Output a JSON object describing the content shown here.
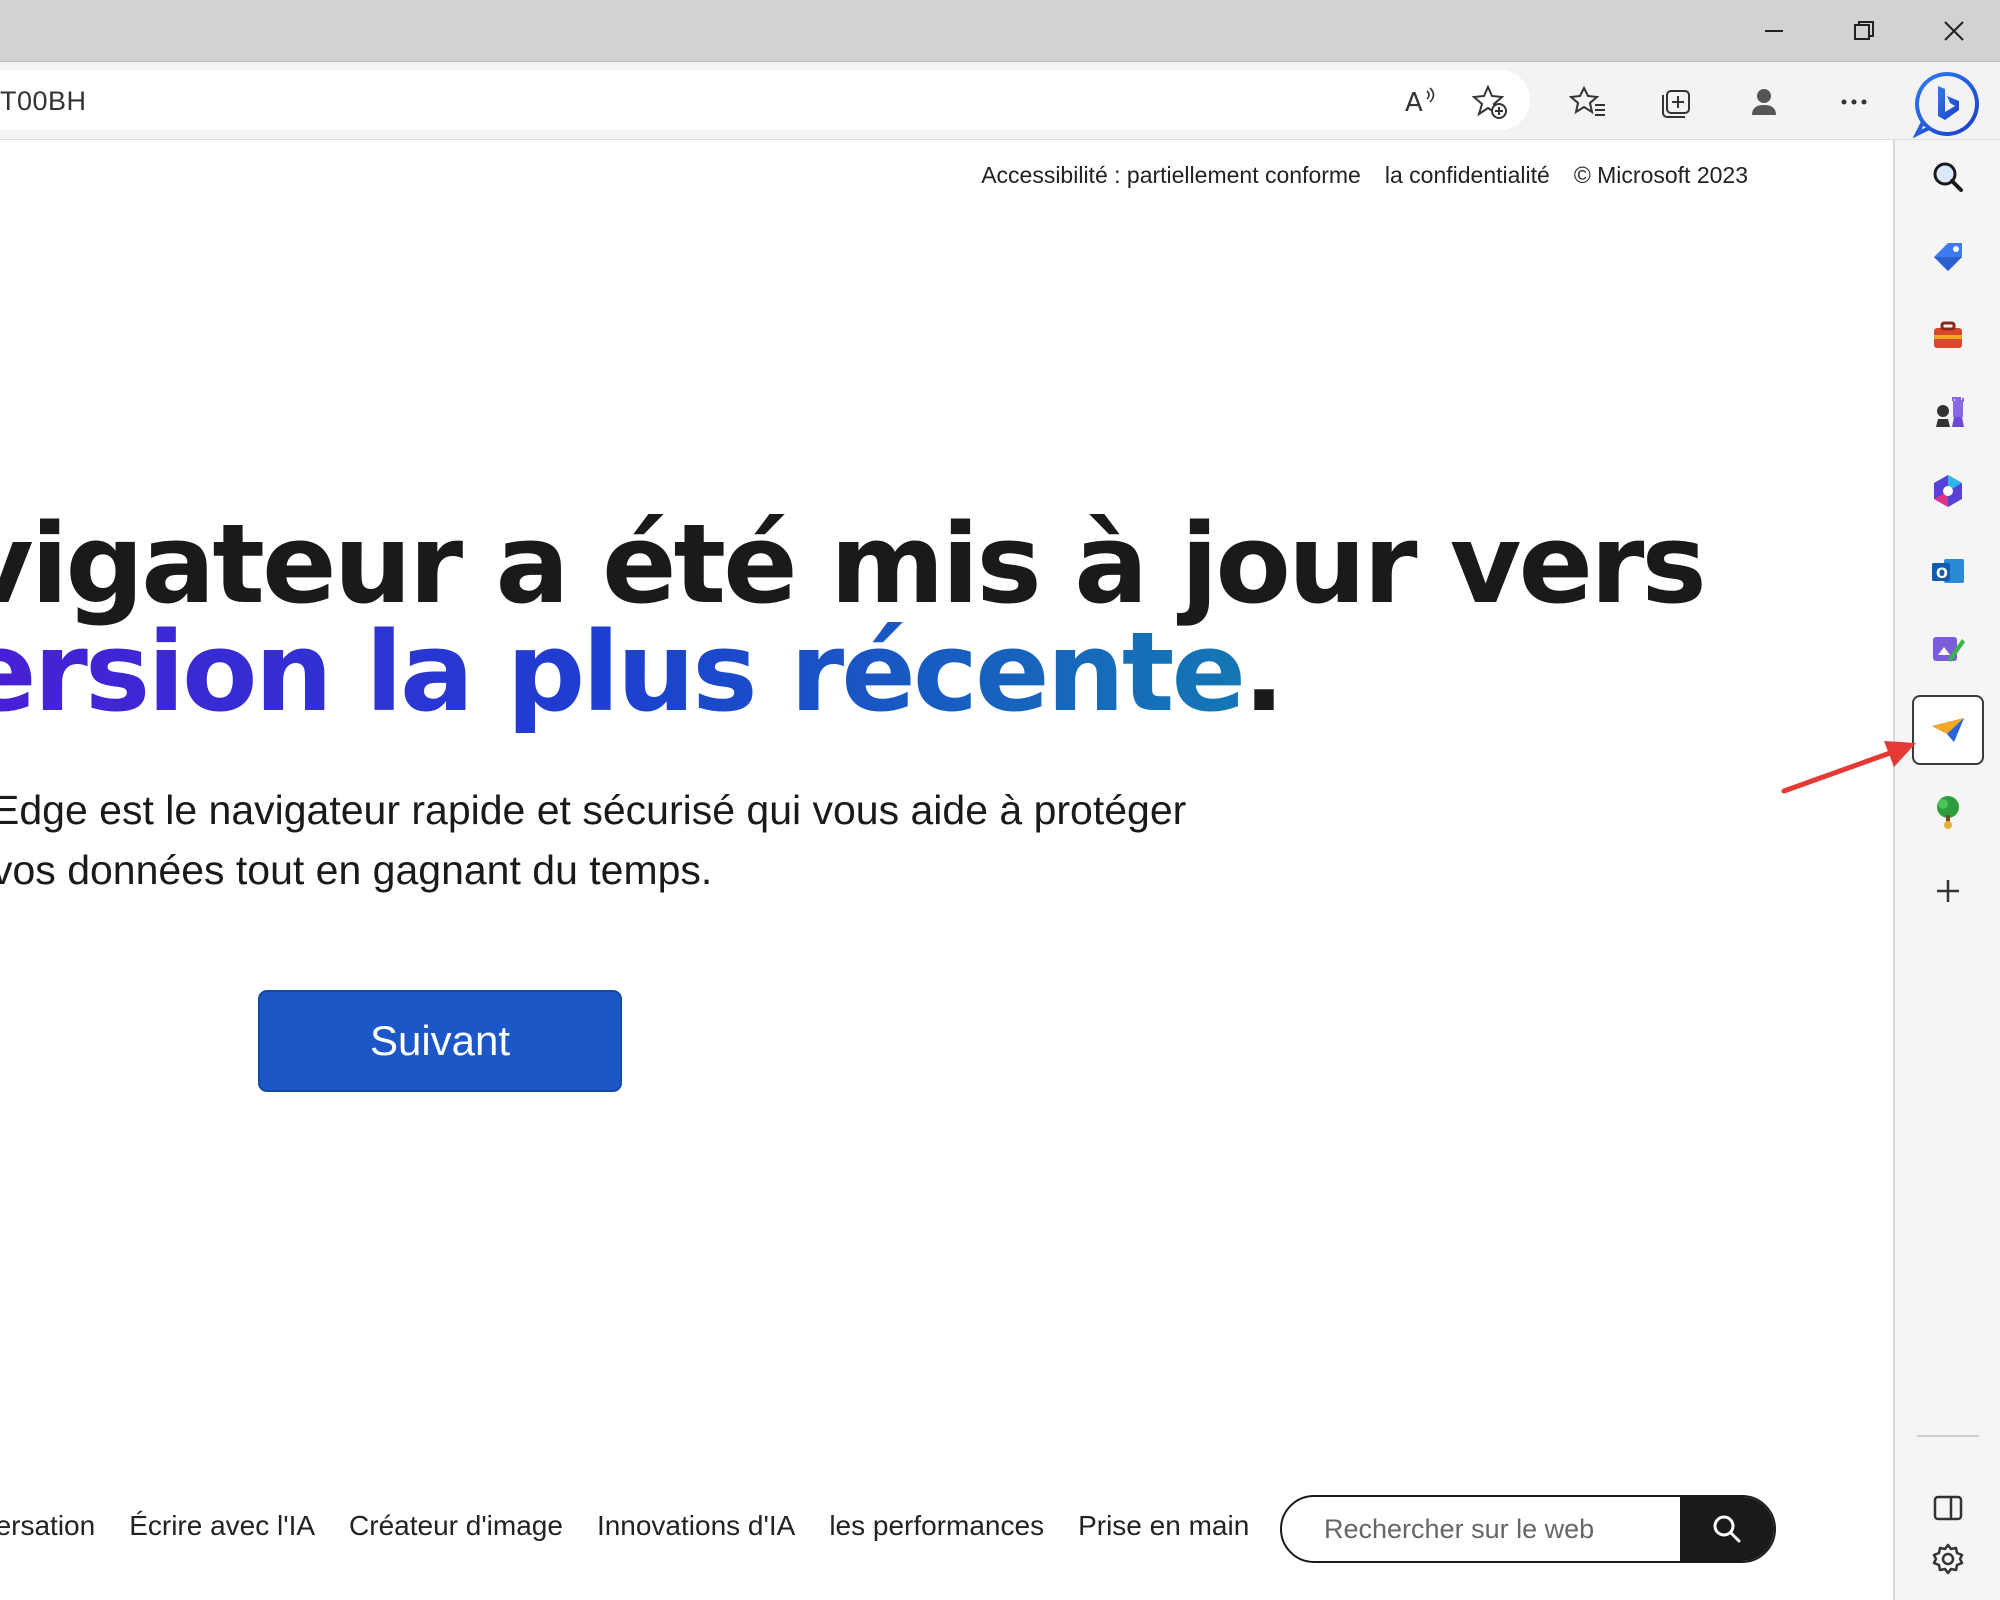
{
  "window": {
    "minimize_icon": "minimize-icon",
    "restore_icon": "restore-icon",
    "close_icon": "close-icon"
  },
  "toolbar": {
    "address_text": "T00BH",
    "icons": [
      "read-aloud-icon",
      "add-favorite-icon",
      "favorites-icon",
      "collections-icon",
      "profile-icon",
      "more-icon",
      "bing-chat-icon"
    ]
  },
  "top_links": {
    "accessibility": "Accessibilité : partiellement conforme",
    "privacy": "la confidentialité",
    "copyright": "© Microsoft 2023"
  },
  "hero": {
    "line1": "vigateur a été mis à jour vers",
    "line2": "ersion la plus récente",
    "line2_end": ".",
    "description": "Edge est le navigateur rapide et sécurisé qui vous aide à protéger vos données tout en gagnant du temps.",
    "next_label": "Suivant"
  },
  "bottom_nav": {
    "items": [
      "nversation",
      "Écrire avec l'IA",
      "Créateur d'image",
      "Innovations d'IA",
      "les performances",
      "Prise en main"
    ]
  },
  "search": {
    "placeholder": "Rechercher sur le web"
  },
  "sidebar": {
    "items": [
      "search-icon",
      "shopping-tag-icon",
      "tools-icon",
      "games-icon",
      "microsoft-365-icon",
      "outlook-icon",
      "drop-icon",
      "telegram-icon",
      "tree-icon",
      "add-icon"
    ],
    "bottom": [
      "split-screen-icon",
      "settings-icon"
    ],
    "active_item": "telegram-icon"
  },
  "colors": {
    "accent": "#1c57c7",
    "gradient_start": "#4a1ed6",
    "gradient_end": "#1477b4",
    "arrow": "#e53935"
  }
}
